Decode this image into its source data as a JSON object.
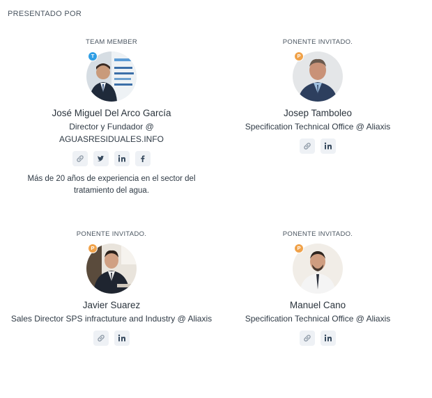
{
  "section_title": "PRESENTADO POR",
  "colors": {
    "badge_team": "#2f9ee4",
    "badge_speaker": "#f0a24a",
    "social_bg": "#eef1f5"
  },
  "speakers": [
    {
      "role": "TEAM MEMBER",
      "badge": "T",
      "name": "José Miguel Del Arco García",
      "title": "Director y Fundador @ AGUASRESIDUALES.INFO",
      "socials": [
        "link-icon",
        "twitter-icon",
        "linkedin-icon",
        "facebook-icon"
      ],
      "bio": "Más de 20 años de experiencia en el sector del tratamiento del agua."
    },
    {
      "role": "PONENTE INVITADO.",
      "badge": "P",
      "name": "Josep Tamboleo",
      "title": "Specification Technical Office @ Aliaxis",
      "socials": [
        "link-icon",
        "linkedin-icon"
      ]
    },
    {
      "role": "PONENTE INVITADO.",
      "badge": "P",
      "name": "Javier Suarez",
      "title": "Sales Director SPS infractuture and Industry @ Aliaxis",
      "socials": [
        "link-icon",
        "linkedin-icon"
      ]
    },
    {
      "role": "PONENTE INVITADO.",
      "badge": "P",
      "name": "Manuel Cano",
      "title": "Specification Technical Office @ Aliaxis",
      "socials": [
        "link-icon",
        "linkedin-icon"
      ]
    }
  ]
}
